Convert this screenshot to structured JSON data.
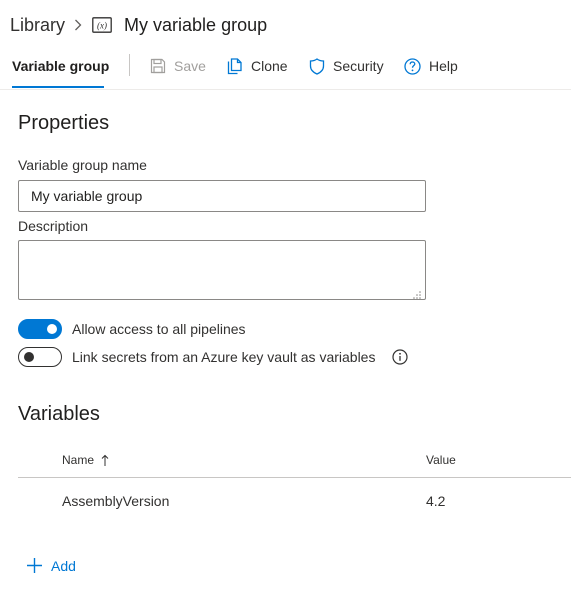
{
  "breadcrumb": {
    "parent": "Library",
    "separator_icon": "chevron-right-icon",
    "group_icon": "variable-icon",
    "group_icon_text": "(x)",
    "current": "My variable group"
  },
  "toolbar": {
    "active_tab": "Variable group",
    "save": {
      "label": "Save",
      "icon": "save-icon",
      "disabled": true
    },
    "clone": {
      "label": "Clone",
      "icon": "clone-icon"
    },
    "security": {
      "label": "Security",
      "icon": "shield-icon"
    },
    "help": {
      "label": "Help",
      "icon": "help-icon"
    }
  },
  "properties": {
    "title": "Properties",
    "name_label": "Variable group name",
    "name_value": "My variable group",
    "description_label": "Description",
    "description_value": "",
    "toggles": [
      {
        "label": "Allow access to all pipelines",
        "on": true
      },
      {
        "label": "Link secrets from an Azure key vault as variables",
        "on": false,
        "info_icon": "info-icon"
      }
    ]
  },
  "variables": {
    "title": "Variables",
    "columns": {
      "name": "Name",
      "value": "Value",
      "sort_icon": "sort-ascending-icon"
    },
    "rows": [
      {
        "name": "AssemblyVersion",
        "value": "4.2"
      }
    ],
    "add_label": "Add",
    "add_icon": "plus-icon"
  },
  "colors": {
    "accent": "#0078d4",
    "text": "#323130",
    "disabled": "#a19f9d"
  }
}
